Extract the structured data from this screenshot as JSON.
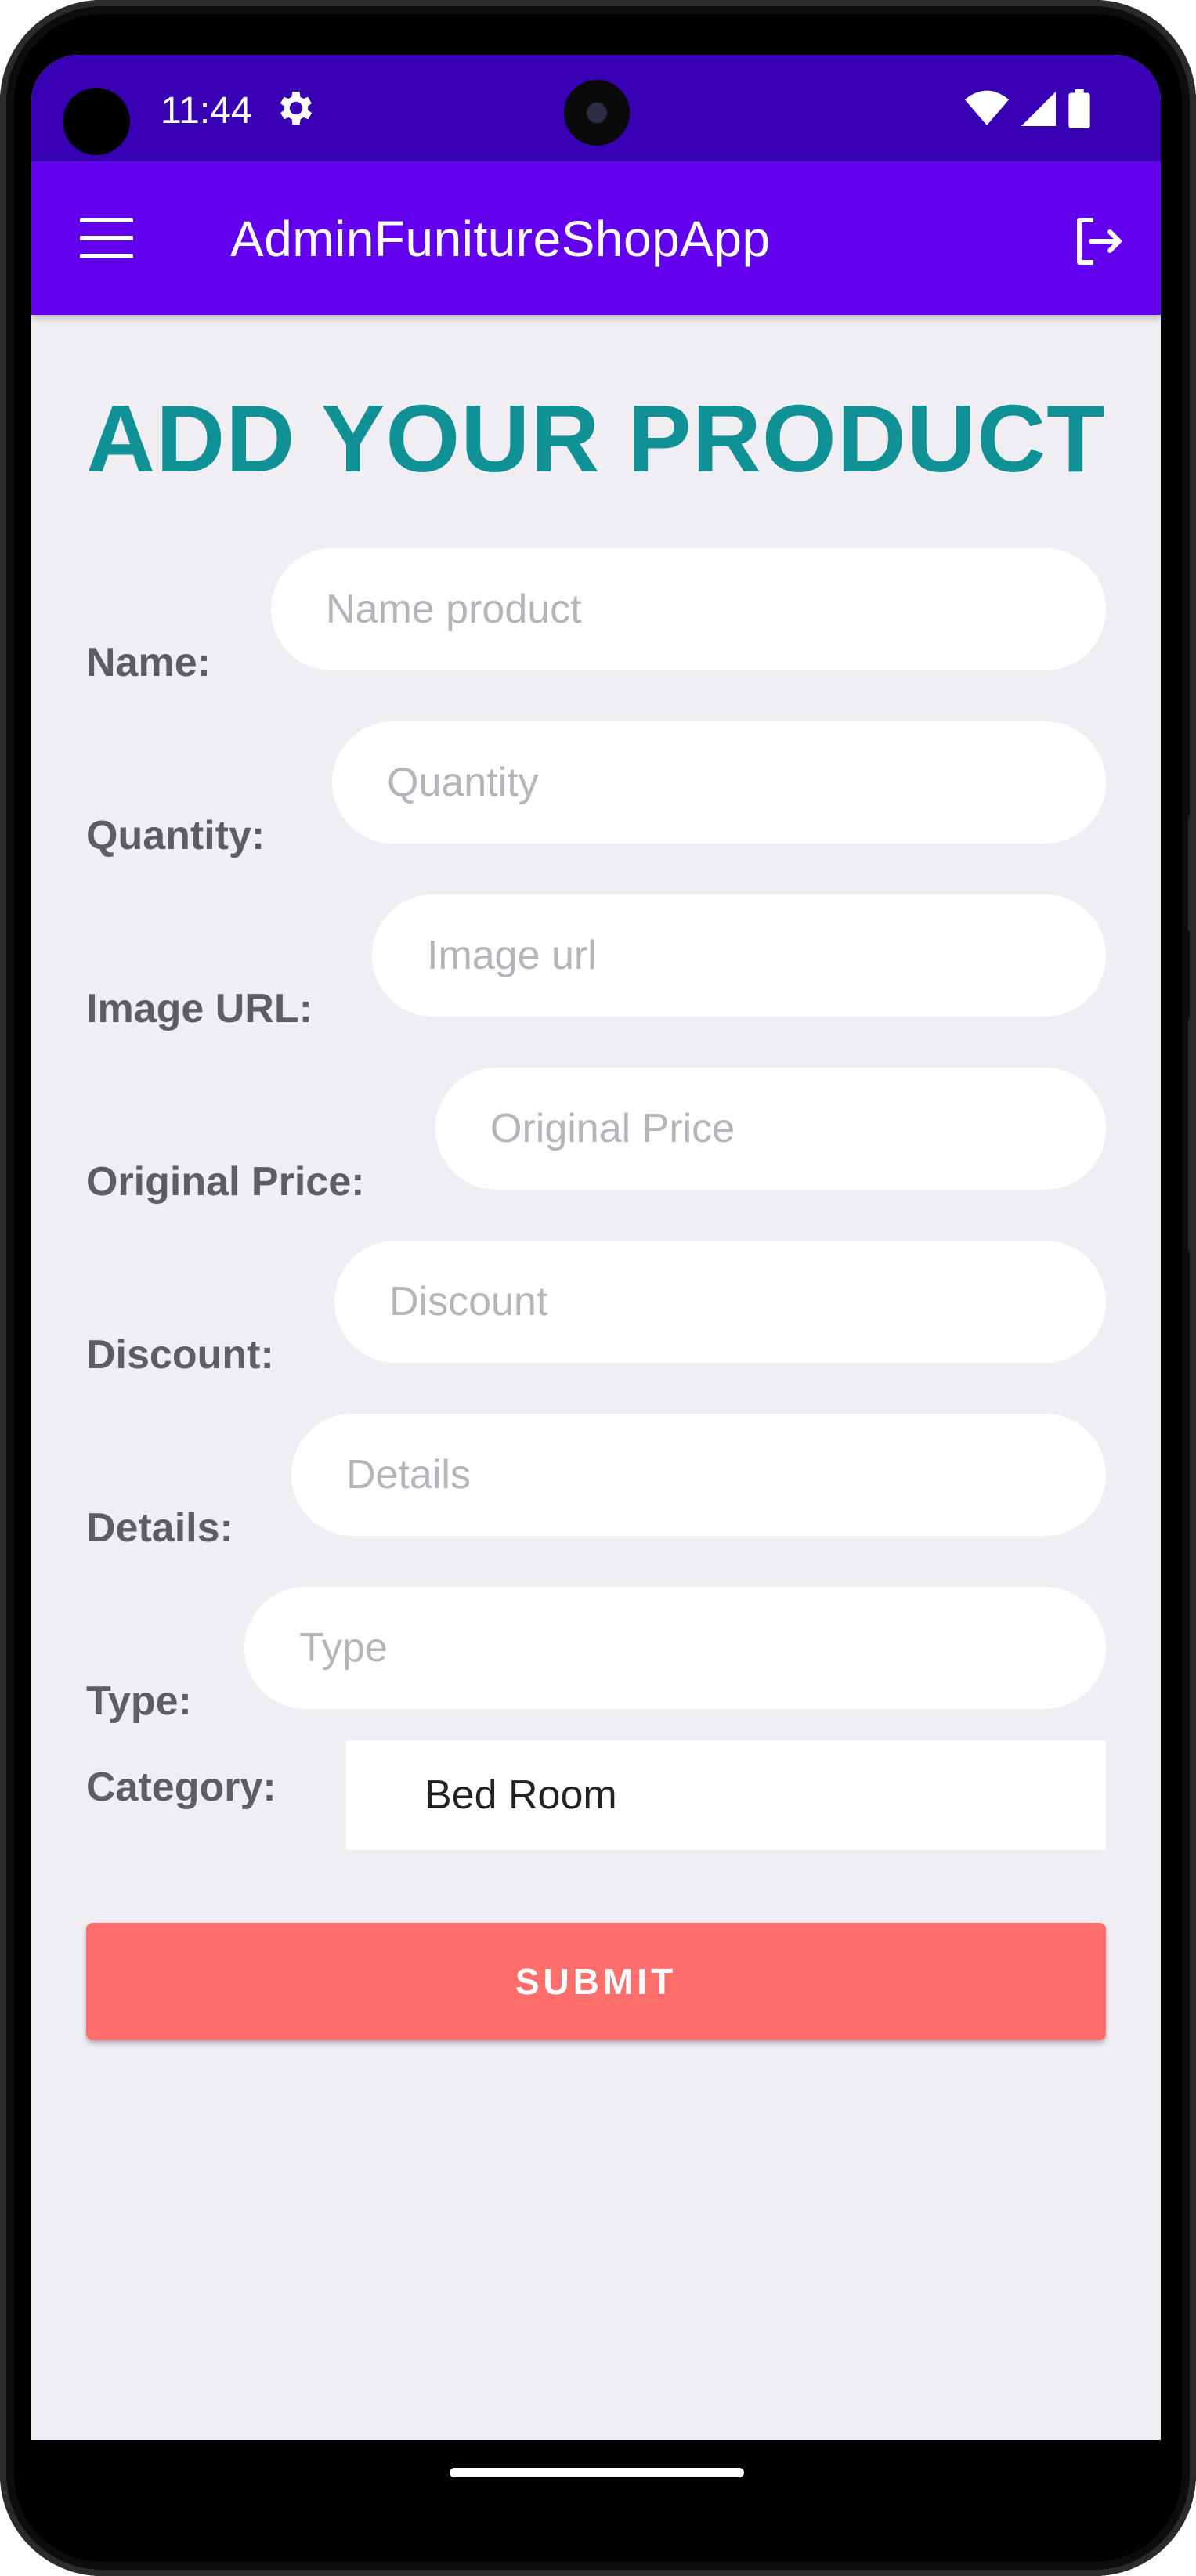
{
  "status_bar": {
    "time": "11:44"
  },
  "toolbar": {
    "title": "AdminFunitureShopApp"
  },
  "form": {
    "heading": "ADD YOUR PRODUCT",
    "fields": [
      {
        "label": "Name:",
        "placeholder": "Name product"
      },
      {
        "label": "Quantity:",
        "placeholder": "Quantity"
      },
      {
        "label": "Image URL:",
        "placeholder": "Image url"
      },
      {
        "label": "Original Price:",
        "placeholder": "Original Price"
      },
      {
        "label": "Discount:",
        "placeholder": "Discount"
      },
      {
        "label": "Details:",
        "placeholder": "Details"
      },
      {
        "label": "Type:",
        "placeholder": "Type"
      }
    ],
    "category": {
      "label": "Category:",
      "selected": "Bed Room"
    },
    "submit_label": "SUBMIT"
  },
  "colors": {
    "status_bar": "#3700b3",
    "toolbar": "#6200ee",
    "heading": "#0f9196",
    "submit": "#ff6e6b",
    "background": "#f1eef3"
  }
}
